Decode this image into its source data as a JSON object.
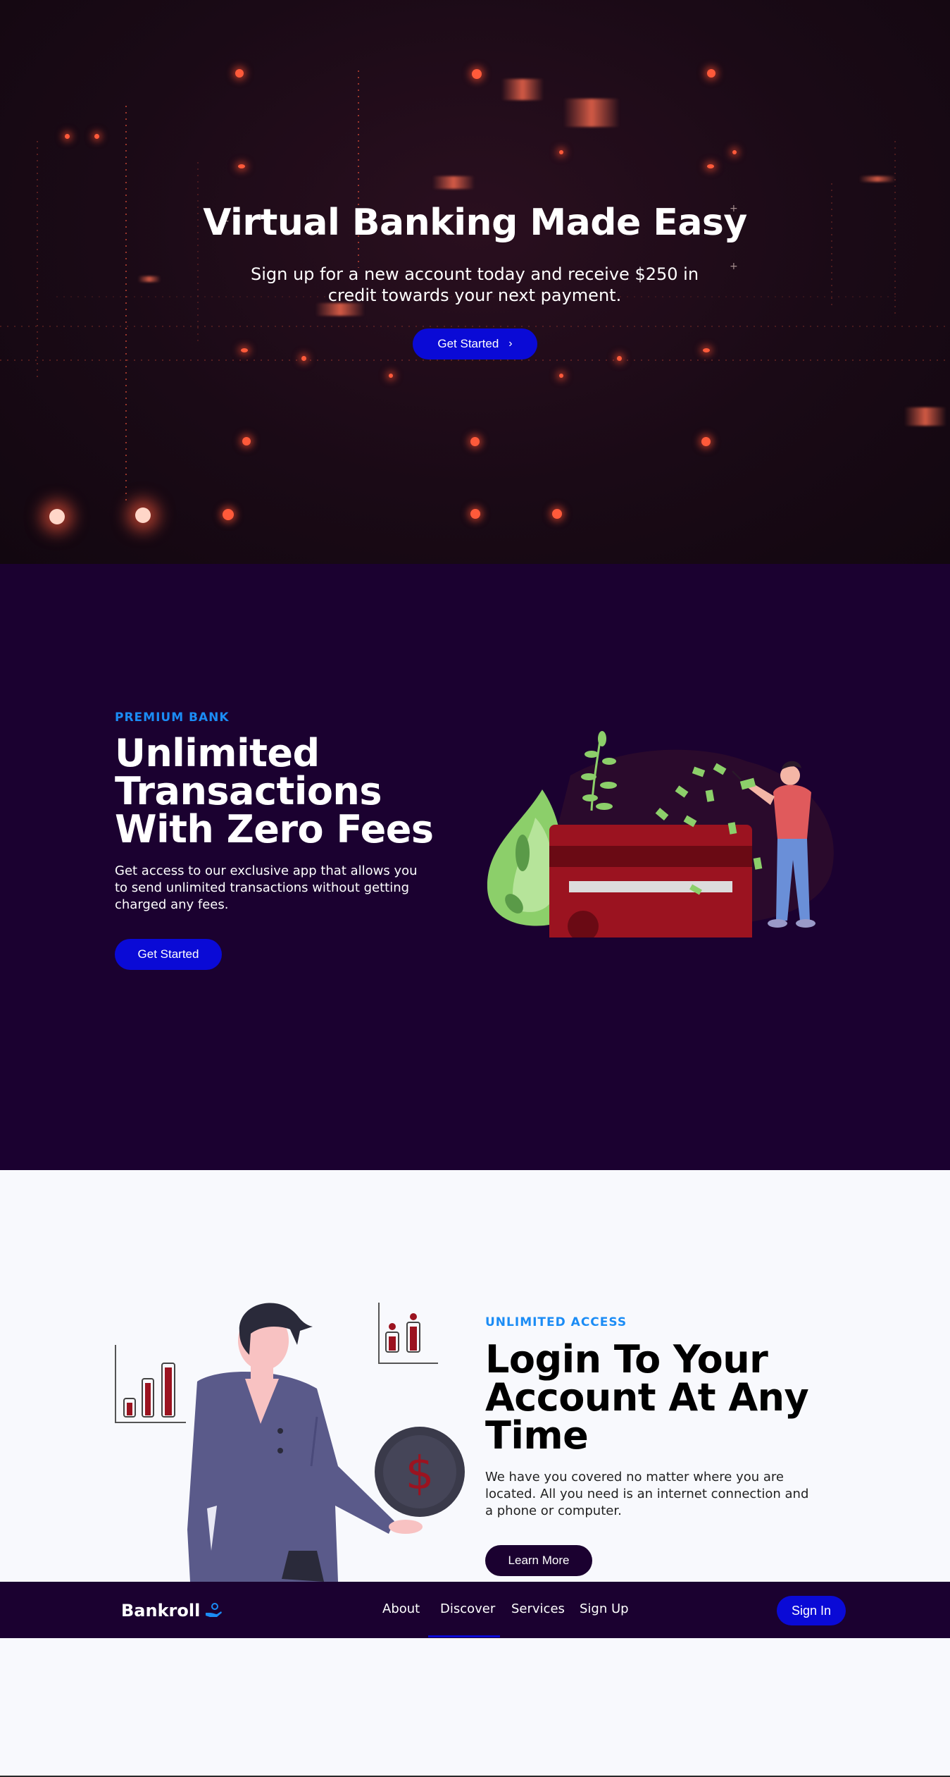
{
  "hero": {
    "title": "Virtual Banking Made Easy",
    "subtitle": "Sign up for a new account today and receive $250 in credit towards your next payment.",
    "button_label": "Get Started"
  },
  "premium": {
    "eyebrow": "PREMIUM BANK",
    "heading": "Unlimited Transactions With Zero Fees",
    "description": "Get access to our exclusive app that allows you to send unlimited transactions without getting charged any fees.",
    "button_label": "Get Started"
  },
  "access": {
    "eyebrow": "UNLIMITED ACCESS",
    "heading": "Login To Your Account At Any Time",
    "description": "We have you covered no matter where you are located. All you need is an internet connection and a phone or computer.",
    "button_label": "Learn More"
  },
  "navbar": {
    "logo_text": "Bankroll",
    "items": [
      "About",
      "Discover",
      "Services",
      "Sign Up"
    ],
    "active_item": "Discover",
    "signin_label": "Sign In"
  },
  "colors": {
    "primary_blue": "#0a0ad6",
    "eyebrow_blue": "#1b8cf5",
    "dark_purple": "#1b0130",
    "hero_bg": "#1a0a16",
    "light_bg": "#f8f9fd",
    "card_red": "#9b1320"
  },
  "icons": {
    "hero_button": "chevron-right-icon",
    "logo": "hand-money-icon"
  }
}
